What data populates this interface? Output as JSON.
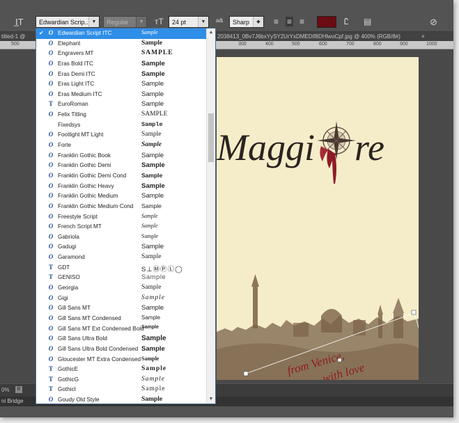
{
  "options_bar": {
    "font_family": "Edwardian Scrip...",
    "font_style": "Regular",
    "font_size": "24 pt",
    "aa_label": "a",
    "antialias": "Sharp",
    "text_color": "#6b0b14"
  },
  "document": {
    "tab_title": "titled-1 @",
    "tab_title_2": "2038413_0Bv7J6bxYySY2UrYxDMEDif8DHlwoCpf.jpg @ 400% (RGB/8#)",
    "close_label": "×",
    "ruler_labels_left": [
      "500"
    ],
    "ruler_labels": [
      "300",
      "400",
      "500",
      "600",
      "700",
      "800",
      "900",
      "1000"
    ]
  },
  "artwork": {
    "headline": "Maggi",
    "headline_tail": "re",
    "script_line1": "from Venice,",
    "script_line2": "with love"
  },
  "bottom": {
    "zoom": "0%",
    "bridge": "ni Bridge"
  },
  "font_list": [
    {
      "name": "Edwardian Script ITC",
      "sample": "Sample",
      "icon": "opentype-icon",
      "selected": true
    },
    {
      "name": "Elephant",
      "sample": "Sample",
      "icon": "opentype-icon"
    },
    {
      "name": "Engravers MT",
      "sample": "SAMPLE",
      "icon": "opentype-icon"
    },
    {
      "name": "Eras Bold ITC",
      "sample": "Sample",
      "icon": "opentype-icon"
    },
    {
      "name": "Eras Demi ITC",
      "sample": "Sample",
      "icon": "opentype-icon"
    },
    {
      "name": "Eras Light ITC",
      "sample": "Sample",
      "icon": "opentype-icon"
    },
    {
      "name": "Eras Medium ITC",
      "sample": "Sample",
      "icon": "opentype-icon"
    },
    {
      "name": "EuroRoman",
      "sample": "Sample",
      "icon": "truetype-icon"
    },
    {
      "name": "Felix Titling",
      "sample": "SAMPLE",
      "icon": "opentype-icon"
    },
    {
      "name": "Fixedsys",
      "sample": "Sample",
      "icon": "none"
    },
    {
      "name": "Footlight MT Light",
      "sample": "Sample",
      "icon": "opentype-icon"
    },
    {
      "name": "Forte",
      "sample": "Sample",
      "icon": "opentype-icon"
    },
    {
      "name": "Franklin Gothic Book",
      "sample": "Sample",
      "icon": "opentype-icon"
    },
    {
      "name": "Franklin Gothic Demi",
      "sample": "Sample",
      "icon": "opentype-icon"
    },
    {
      "name": "Franklin Gothic Demi Cond",
      "sample": "Sample",
      "icon": "opentype-icon"
    },
    {
      "name": "Franklin Gothic Heavy",
      "sample": "Sample",
      "icon": "opentype-icon"
    },
    {
      "name": "Franklin Gothic Medium",
      "sample": "Sample",
      "icon": "opentype-icon"
    },
    {
      "name": "Franklin Gothic Medium Cond",
      "sample": "Sample",
      "icon": "opentype-icon"
    },
    {
      "name": "Freestyle Script",
      "sample": "Sample",
      "icon": "opentype-icon"
    },
    {
      "name": "French Script MT",
      "sample": "Sample",
      "icon": "opentype-icon"
    },
    {
      "name": "Gabriola",
      "sample": "Sample",
      "icon": "opentype-icon"
    },
    {
      "name": "Gadugi",
      "sample": "Sample",
      "icon": "opentype-icon"
    },
    {
      "name": "Garamond",
      "sample": "Sample",
      "icon": "opentype-icon"
    },
    {
      "name": "GDT",
      "sample": "S⊥ⓂⓅⓁ◯",
      "icon": "truetype-icon"
    },
    {
      "name": "GENISO",
      "sample": "Sample",
      "icon": "truetype-icon"
    },
    {
      "name": "Georgia",
      "sample": "Sample",
      "icon": "opentype-icon"
    },
    {
      "name": "Gigi",
      "sample": "Sample",
      "icon": "opentype-icon"
    },
    {
      "name": "Gill Sans MT",
      "sample": "Sample",
      "icon": "opentype-icon"
    },
    {
      "name": "Gill Sans MT Condensed",
      "sample": "Sample",
      "icon": "opentype-icon"
    },
    {
      "name": "Gill Sans MT Ext Condensed Bold",
      "sample": "Sample",
      "icon": "opentype-icon"
    },
    {
      "name": "Gill Sans Ultra Bold",
      "sample": "Sample",
      "icon": "opentype-icon"
    },
    {
      "name": "Gill Sans Ultra Bold Condensed",
      "sample": "Sample",
      "icon": "opentype-icon"
    },
    {
      "name": "Gloucester MT Extra Condensed",
      "sample": "Sample",
      "icon": "opentype-icon"
    },
    {
      "name": "GothicE",
      "sample": "Sample",
      "icon": "truetype-icon"
    },
    {
      "name": "GothicG",
      "sample": "Sample",
      "icon": "truetype-icon"
    },
    {
      "name": "GothicI",
      "sample": "Sample",
      "icon": "truetype-icon"
    },
    {
      "name": "Goudy Old Style",
      "sample": "Sample",
      "icon": "opentype-icon"
    }
  ]
}
